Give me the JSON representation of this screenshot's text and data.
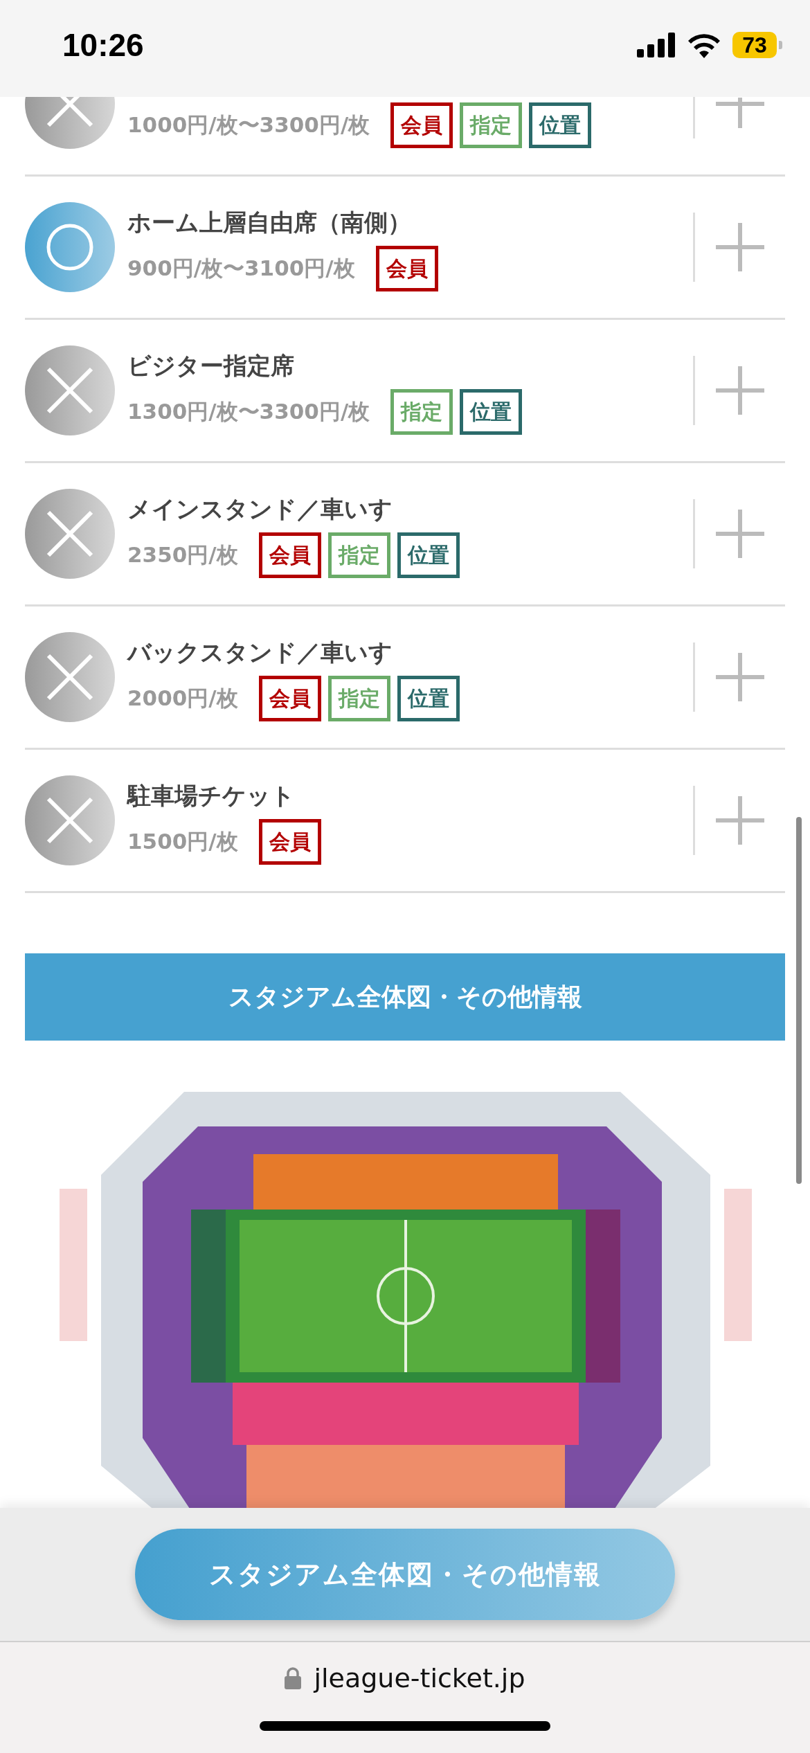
{
  "status_bar": {
    "time": "10:26",
    "battery": "73"
  },
  "tickets": [
    {
      "price": "1000円/枚〜3300円/枚",
      "available": false,
      "badges": [
        {
          "kind": "member",
          "label": "会員"
        },
        {
          "kind": "reserved",
          "label": "指定"
        },
        {
          "kind": "position",
          "label": "位置"
        }
      ]
    },
    {
      "name": "ホーム上層自由席（南側）",
      "price": "900円/枚〜3100円/枚",
      "available": true,
      "badges": [
        {
          "kind": "member",
          "label": "会員"
        }
      ]
    },
    {
      "name": "ビジター指定席",
      "price": "1300円/枚〜3300円/枚",
      "available": false,
      "badges": [
        {
          "kind": "reserved",
          "label": "指定"
        },
        {
          "kind": "position",
          "label": "位置"
        }
      ]
    },
    {
      "name": "メインスタンド／車いす",
      "price": "2350円/枚",
      "available": false,
      "badges": [
        {
          "kind": "member",
          "label": "会員"
        },
        {
          "kind": "reserved",
          "label": "指定"
        },
        {
          "kind": "position",
          "label": "位置"
        }
      ]
    },
    {
      "name": "バックスタンド／車いす",
      "price": "2000円/枚",
      "available": false,
      "badges": [
        {
          "kind": "member",
          "label": "会員"
        },
        {
          "kind": "reserved",
          "label": "指定"
        },
        {
          "kind": "position",
          "label": "位置"
        }
      ]
    },
    {
      "name": "駐車場チケット",
      "price": "1500円/枚",
      "available": false,
      "badges": [
        {
          "kind": "member",
          "label": "会員"
        }
      ]
    }
  ],
  "banner": {
    "title": "スタジアム全体図・その他情報"
  },
  "floating_button": {
    "label": "スタジアム全体図・その他情報"
  },
  "browser_bar": {
    "url": "jleague-ticket.jp"
  }
}
